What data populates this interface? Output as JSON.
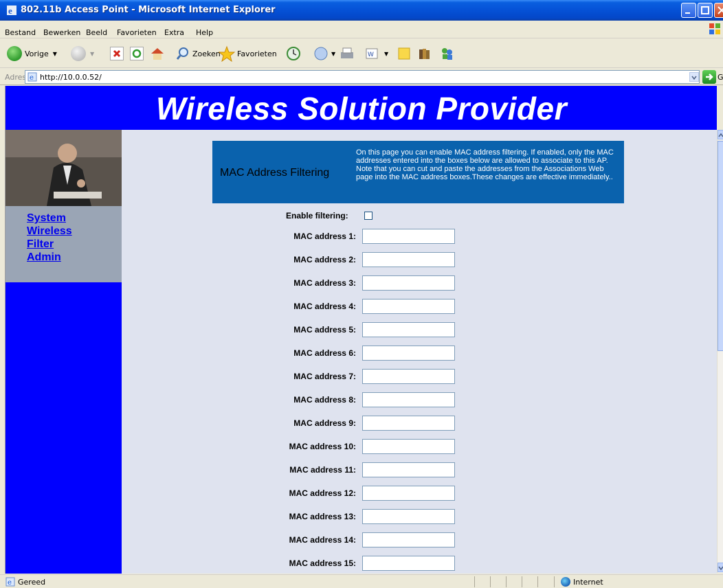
{
  "window": {
    "title": "802.11b Access Point - Microsoft Internet Explorer"
  },
  "menu": {
    "items": [
      "Bestand",
      "Bewerken",
      "Beeld",
      "Favorieten",
      "Extra",
      "Help"
    ]
  },
  "toolbar": {
    "back_label": "Vorige",
    "search_label": "Zoeken",
    "favorites_label": "Favorieten"
  },
  "address": {
    "label": "Adres",
    "url": "http://10.0.0.52/",
    "go_label": "Ga naar"
  },
  "page": {
    "brand": "Wireless Solution Provider",
    "nav": [
      "System",
      "Wireless",
      "Filter",
      "Admin"
    ],
    "heading": "MAC Address Filtering",
    "description": "On this page you can enable MAC address filtering. If enabled, only the MAC addresses entered into the boxes below are allowed to associate to this AP. Note that you can cut and paste the addresses from the Associations Web page into the MAC address boxes.These changes are effective immediately..",
    "enable_label": "Enable filtering:",
    "enable_checked": false,
    "mac_fields": [
      {
        "label": "MAC address 1:",
        "value": ""
      },
      {
        "label": "MAC address 2:",
        "value": ""
      },
      {
        "label": "MAC address 3:",
        "value": ""
      },
      {
        "label": "MAC address 4:",
        "value": ""
      },
      {
        "label": "MAC address 5:",
        "value": ""
      },
      {
        "label": "MAC address 6:",
        "value": ""
      },
      {
        "label": "MAC address 7:",
        "value": ""
      },
      {
        "label": "MAC address 8:",
        "value": ""
      },
      {
        "label": "MAC address 9:",
        "value": ""
      },
      {
        "label": "MAC address 10:",
        "value": ""
      },
      {
        "label": "MAC address 11:",
        "value": ""
      },
      {
        "label": "MAC address 12:",
        "value": ""
      },
      {
        "label": "MAC address 13:",
        "value": ""
      },
      {
        "label": "MAC address 14:",
        "value": ""
      },
      {
        "label": "MAC address 15:",
        "value": ""
      }
    ]
  },
  "status": {
    "text": "Gereed",
    "zone": "Internet"
  },
  "colors": {
    "banner": "#0000ff",
    "info_box": "#0a62ad",
    "content_bg": "#dfe3ef",
    "nav_box": "#9aa5b5"
  }
}
